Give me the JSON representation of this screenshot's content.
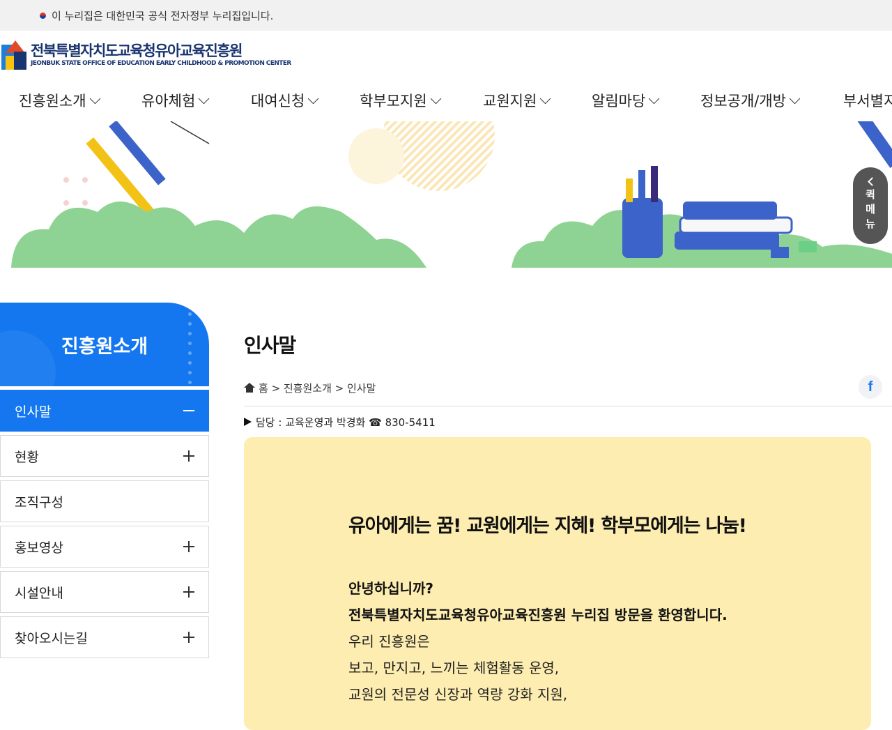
{
  "topbar": {
    "text": "이 누리집은 대한민국 공식 전자정부 누리집입니다."
  },
  "logo": {
    "ko": "전북특별자치도교육청유아교육진흥원",
    "en": "JEONBUK STATE OFFICE OF EDUCATION EARLY CHILDHOOD & PROMOTION CENTER"
  },
  "gnb": {
    "items": [
      "진흥원소개",
      "유아체험",
      "대여신청",
      "학부모지원",
      "교원지원",
      "알림마당",
      "정보공개/개방",
      "부서별지"
    ]
  },
  "quick_menu": {
    "label_chars": [
      "퀵",
      "메",
      "뉴"
    ]
  },
  "sidebar": {
    "title": "진흥원소개",
    "items": [
      {
        "label": "인사말",
        "state": "active"
      },
      {
        "label": "현황",
        "state": "plus"
      },
      {
        "label": "조직구성",
        "state": "none"
      },
      {
        "label": "홍보영상",
        "state": "plus"
      },
      {
        "label": "시설안내",
        "state": "plus"
      },
      {
        "label": "찾아오시는길",
        "state": "plus"
      }
    ]
  },
  "content": {
    "title": "인사말",
    "breadcrumb": "홈 > 진흥원소개 > 인사말",
    "facebook_label": "f",
    "manager": "담당 : 교육운영과 박경화 ☎ 830-5411",
    "greeting": {
      "title": "유아에게는 꿈! 교원에게는 지혜! 학부모에게는 나눔!",
      "line1": "안녕하십니까?",
      "line2": "전북특별자치도교육청유아교육진흥원 누리집 방문을 환영합니다.",
      "line3": "우리 진흥원은",
      "line4": "보고, 만지고, 느끼는 체험활동 운영,",
      "line5": "교원의 전문성 신장과 역량 강화 지원,"
    }
  },
  "colors": {
    "primary": "#1477f0",
    "greeting_bg": "#fdedb0",
    "logo_navy": "#19346f"
  }
}
